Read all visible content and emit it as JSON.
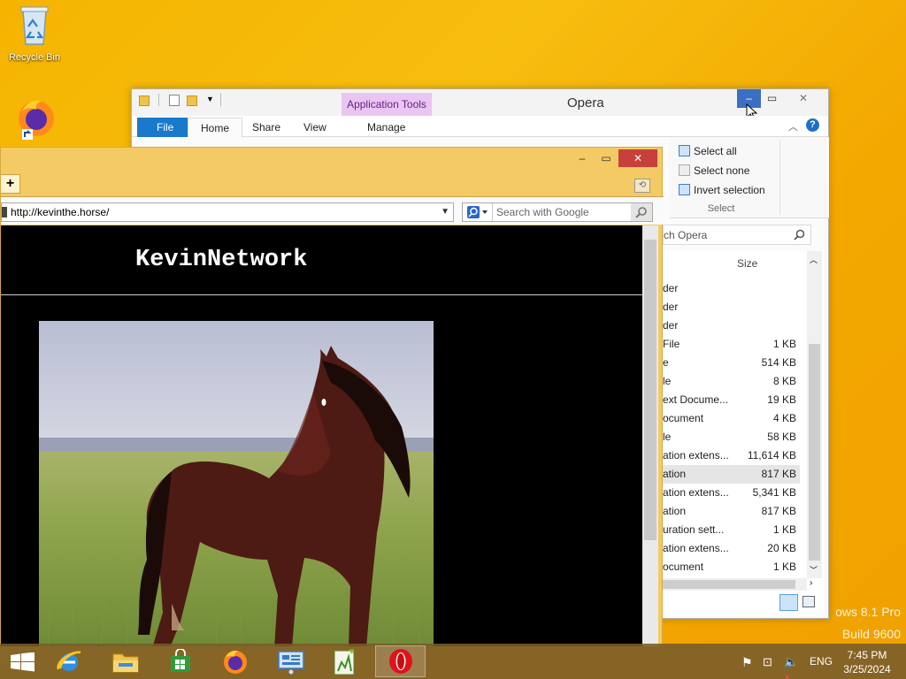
{
  "desktop": {
    "icons": [
      {
        "label": "Recycle Bin",
        "icon": "recycle-bin-icon"
      },
      {
        "label": "",
        "icon": "firefox-shortcut-icon"
      }
    ],
    "watermark": {
      "line1": "ows 8.1 Pro",
      "line2": "Build 9600"
    }
  },
  "explorer": {
    "title": "Opera",
    "context_tab": "Application Tools",
    "tabs": [
      {
        "label": "File"
      },
      {
        "label": "Home"
      },
      {
        "label": "Share"
      },
      {
        "label": "View"
      },
      {
        "label": "Manage"
      }
    ],
    "ribbon": {
      "select_all": "Select all",
      "select_none": "Select none",
      "invert_selection": "Invert selection",
      "group_label": "Select"
    },
    "search_placeholder": "ch Opera",
    "columns": {
      "size": "Size"
    },
    "rows": [
      {
        "name": "der",
        "size": ""
      },
      {
        "name": "der",
        "size": ""
      },
      {
        "name": "der",
        "size": ""
      },
      {
        "name": "File",
        "size": "1 KB"
      },
      {
        "name": "e",
        "size": "514 KB"
      },
      {
        "name": "le",
        "size": "8 KB"
      },
      {
        "name": "ext Docume...",
        "size": "19 KB"
      },
      {
        "name": "ocument",
        "size": "4 KB"
      },
      {
        "name": "le",
        "size": "58 KB"
      },
      {
        "name": "ation extens...",
        "size": "11,614 KB"
      },
      {
        "name": "ation",
        "size": "817 KB"
      },
      {
        "name": "ation extens...",
        "size": "5,341 KB"
      },
      {
        "name": "ation",
        "size": "817 KB"
      },
      {
        "name": "uration sett...",
        "size": "1 KB"
      },
      {
        "name": "ation extens...",
        "size": "20 KB"
      },
      {
        "name": "ocument",
        "size": "1 KB"
      }
    ],
    "selected_row": 10
  },
  "browser": {
    "url": "http://kevinthe.horse/",
    "search_placeholder": "Search with Google",
    "page_title": "KevinNetwork"
  },
  "taskbar": {
    "apps": [
      "internet-explorer",
      "file-explorer",
      "store",
      "firefox",
      "remote-desktop",
      "notepad-plus",
      "opera"
    ],
    "active_app": "opera",
    "language": "ENG",
    "time": "7:45 PM",
    "date": "3/25/2024"
  },
  "colors": {
    "desktop": "#f5b400",
    "file_tab": "#1979ca",
    "context_tab": "#e9c5f1",
    "browser_frame": "#f3ca63",
    "close_button": "#c7403a"
  }
}
